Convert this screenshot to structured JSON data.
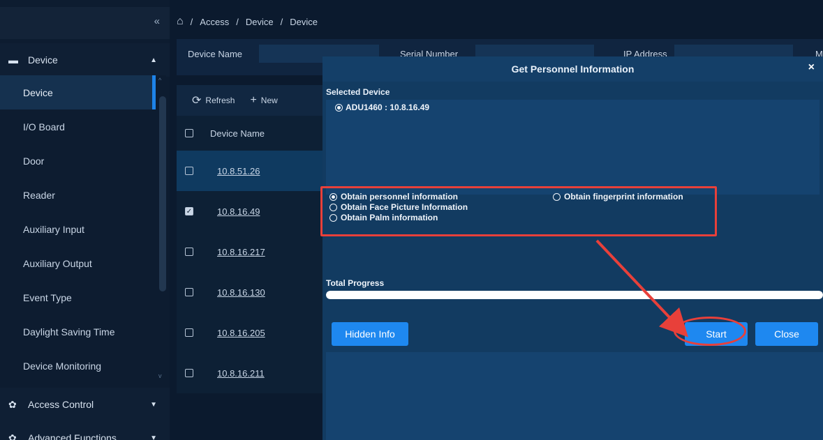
{
  "sidebar": {
    "collapse_icon": "double-chevron-left-icon",
    "group_device": {
      "label": "Device",
      "icon": "device-icon",
      "chevron": "chevron-up-icon"
    },
    "items": [
      {
        "label": "Device",
        "active": true
      },
      {
        "label": "I/O Board"
      },
      {
        "label": "Door"
      },
      {
        "label": "Reader"
      },
      {
        "label": "Auxiliary Input"
      },
      {
        "label": "Auxiliary Output"
      },
      {
        "label": "Event Type"
      },
      {
        "label": "Daylight Saving Time"
      },
      {
        "label": "Device Monitoring"
      }
    ],
    "group_access": {
      "label": "Access Control",
      "icon": "gear-icon"
    },
    "group_advanced": {
      "label": "Advanced Functions",
      "icon": "gear-icon"
    }
  },
  "breadcrumb": {
    "home_icon": "home-icon",
    "sep": "/",
    "items": [
      "Access",
      "Device",
      "Device"
    ]
  },
  "filters": {
    "device_name_label": "Device Name",
    "serial_number_label": "Serial Number",
    "ip_address_label": "IP Address",
    "extra_label": "M"
  },
  "toolbar": {
    "refresh_label": "Refresh",
    "new_label": "New"
  },
  "table": {
    "header": "Device Name",
    "rows": [
      {
        "name": "10.8.51.26",
        "checked": false
      },
      {
        "name": "10.8.16.49",
        "checked": true
      },
      {
        "name": "10.8.16.217",
        "checked": false
      },
      {
        "name": "10.8.16.130",
        "checked": false
      },
      {
        "name": "10.8.16.205",
        "checked": false
      },
      {
        "name": "10.8.16.211",
        "checked": false
      }
    ]
  },
  "modal": {
    "title": "Get Personnel Information",
    "close_icon": "×",
    "selected_device_label": "Selected Device",
    "selected_device": "ADU1460 : 10.8.16.49",
    "options": {
      "personnel": "Obtain personnel information",
      "fingerprint": "Obtain fingerprint information",
      "face": "Obtain Face Picture Information",
      "palm": "Obtain Palm information",
      "selected": "personnel"
    },
    "progress_label": "Total Progress",
    "progress_value": 100,
    "hidden_info_label": "Hidden Info",
    "start_label": "Start",
    "close_label": "Close"
  },
  "colors": {
    "accent": "#1e88f0",
    "highlight": "#e8403a"
  }
}
